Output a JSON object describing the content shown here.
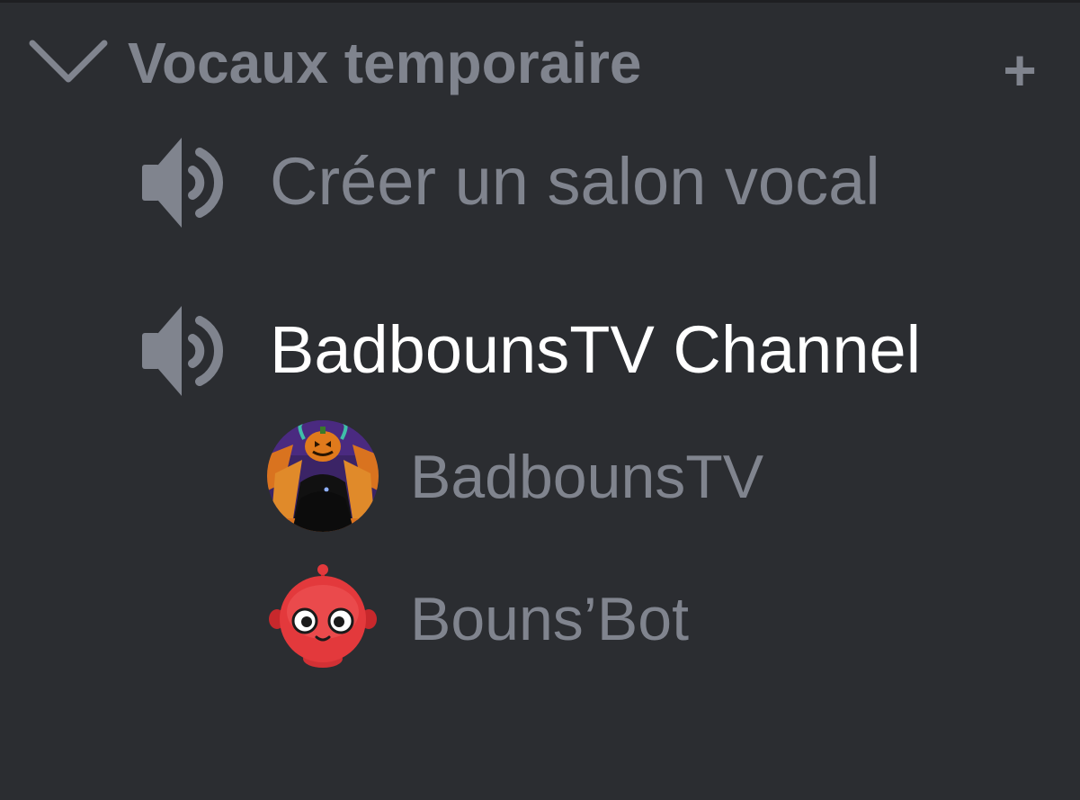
{
  "category": {
    "label": "Vocaux temporaire",
    "collapse_icon": "chevron-down-icon",
    "add_icon": "plus-icon",
    "add_glyph": "+"
  },
  "channels": [
    {
      "label": "Créer un salon vocal",
      "icon": "speaker-icon",
      "active": false
    },
    {
      "label": "BadbounsTV Channel",
      "icon": "speaker-icon",
      "active": true,
      "members": [
        {
          "name": "BadbounsTV",
          "avatar": "pumpkin-head-avatar"
        },
        {
          "name": "Bouns’Bot",
          "avatar": "red-robot-avatar"
        }
      ]
    }
  ],
  "colors": {
    "background": "#2b2d31",
    "muted_text": "#80848e",
    "active_text": "#ffffff"
  }
}
